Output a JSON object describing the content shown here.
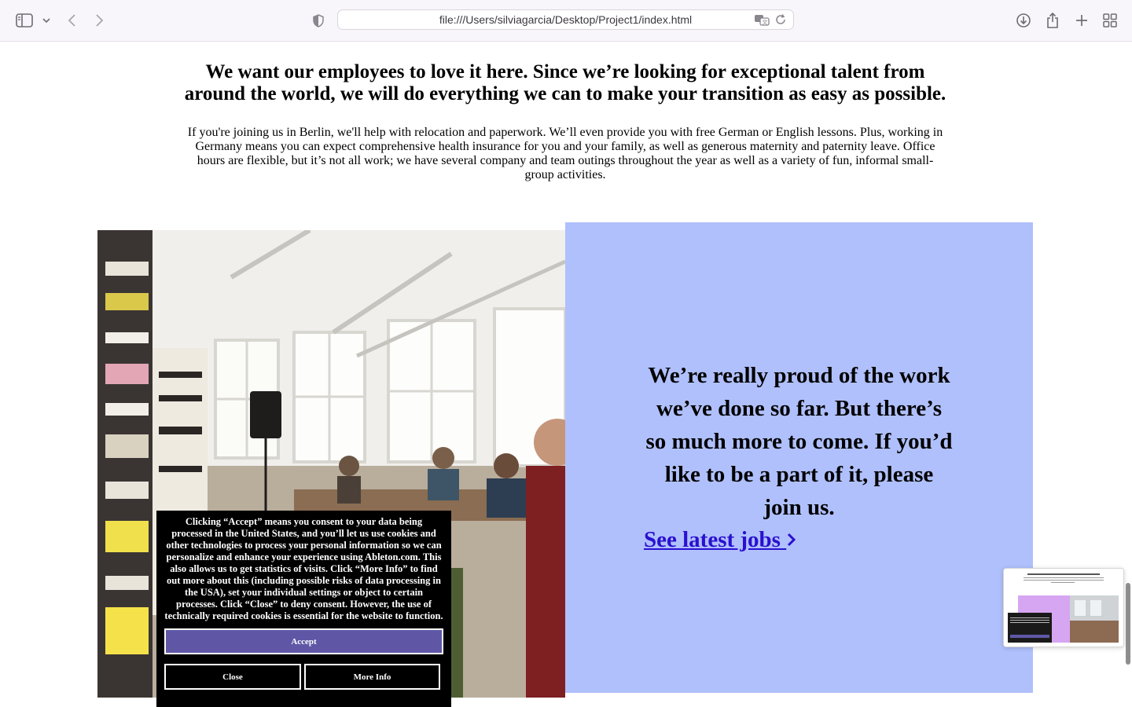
{
  "browser": {
    "url": "file:///Users/silviagarcia/Desktop/Project1/index.html",
    "icons": [
      "sidebar-icon",
      "chevron-down-icon",
      "back-icon",
      "forward-icon",
      "shield-icon",
      "translate-icon",
      "reload-icon",
      "download-icon",
      "share-icon",
      "new-tab-icon",
      "tab-overview-icon"
    ]
  },
  "intro": {
    "heading": "We want our employees to love it here. Since we’re looking for exceptional talent from around the world, we will do everything we can to make your transition as easy as possible.",
    "body": "If you're joining us in Berlin, we'll help with relocation and paperwork. We’ll even provide you with free German or English lessons. Plus, working in Germany means you can expect comprehensive health insurance for you and your family, as well as generous maternity and paternity leave. Office hours are flexible, but it’s not all work; we have several company and team outings throughout the year as well as a variety of fun, informal small-group activities."
  },
  "cta": {
    "heading": "We’re really proud of the work we’ve done so far. But there’s so much more to come. If you’d like to be a part of it, please join us.",
    "link_label": "See latest jobs",
    "background": "#b0c0fc",
    "link_color": "#2a10d0"
  },
  "cookie": {
    "text": "Clicking “Accept” means you consent to your data being processed in the United States, and you’ll let us use cookies and other technologies to process your personal information so we can personalize and enhance your experience using Ableton.com. This also allows us to get statistics of visits. Click “More Info” to find out more about this (including possible risks of data processing in the USA), set your individual settings or object to certain processes. Click “Close” to deny consent. However, the use of technically required cookies is essential for the website to function.",
    "accept_label": "Accept",
    "close_label": "Close",
    "more_label": "More Info",
    "accept_color": "#5f57a6"
  }
}
